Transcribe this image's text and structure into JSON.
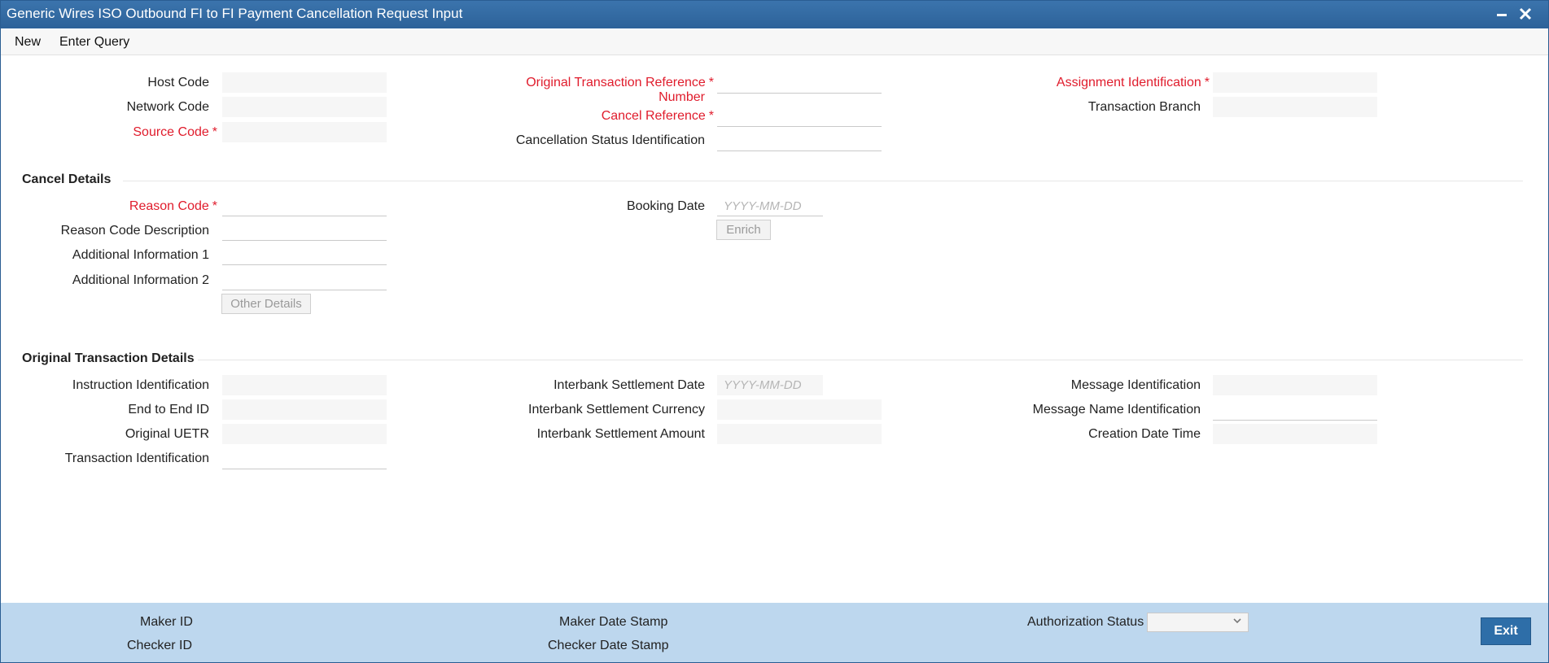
{
  "window": {
    "title": "Generic Wires ISO Outbound FI to FI Payment Cancellation Request Input",
    "minimize_icon": "minimize-icon",
    "close_icon": "close-icon"
  },
  "menu": {
    "new": "New",
    "enter_query": "Enter Query"
  },
  "header": {
    "host_code": {
      "label": "Host Code",
      "value": ""
    },
    "network_code": {
      "label": "Network Code",
      "value": ""
    },
    "source_code": {
      "label": "Source Code",
      "value": ""
    },
    "orig_txn_ref": {
      "label_line1": "Original Transaction Reference",
      "label_line2": "Number",
      "value": ""
    },
    "cancel_ref": {
      "label": "Cancel Reference",
      "value": ""
    },
    "cancel_status_id": {
      "label": "Cancellation Status Identification",
      "value": ""
    },
    "assignment_id": {
      "label": "Assignment Identification",
      "value": ""
    },
    "txn_branch": {
      "label": "Transaction Branch",
      "value": ""
    }
  },
  "required_marker": "*",
  "cancel_details": {
    "title": "Cancel Details",
    "reason_code": {
      "label": "Reason Code",
      "value": ""
    },
    "reason_desc": {
      "label": "Reason Code Description",
      "value": ""
    },
    "add_info1": {
      "label": "Additional Information 1",
      "value": ""
    },
    "add_info2": {
      "label": "Additional Information 2",
      "value": ""
    },
    "other_details_button": "Other Details",
    "booking_date": {
      "label": "Booking Date",
      "placeholder": "YYYY-MM-DD"
    },
    "enrich_button": "Enrich"
  },
  "original_txn": {
    "title": "Original Transaction Details",
    "instruction_id": {
      "label": "Instruction Identification",
      "value": ""
    },
    "end_to_end_id": {
      "label": "End to End ID",
      "value": ""
    },
    "original_uetr": {
      "label": "Original UETR",
      "value": ""
    },
    "txn_id": {
      "label": "Transaction Identification",
      "value": ""
    },
    "settle_date": {
      "label": "Interbank Settlement Date",
      "placeholder": "YYYY-MM-DD"
    },
    "settle_currency": {
      "label": "Interbank Settlement Currency",
      "value": ""
    },
    "settle_amount": {
      "label": "Interbank Settlement Amount",
      "value": ""
    },
    "message_id": {
      "label": "Message Identification",
      "value": ""
    },
    "message_name_id": {
      "label": "Message Name Identification",
      "value": ""
    },
    "creation_dt": {
      "label": "Creation Date Time",
      "value": ""
    }
  },
  "footer": {
    "maker_id": "Maker ID",
    "checker_id": "Checker ID",
    "maker_date_stamp": "Maker Date Stamp",
    "checker_date_stamp": "Checker Date Stamp",
    "authorization_status": "Authorization Status",
    "authorization_value": "",
    "exit_button": "Exit"
  }
}
